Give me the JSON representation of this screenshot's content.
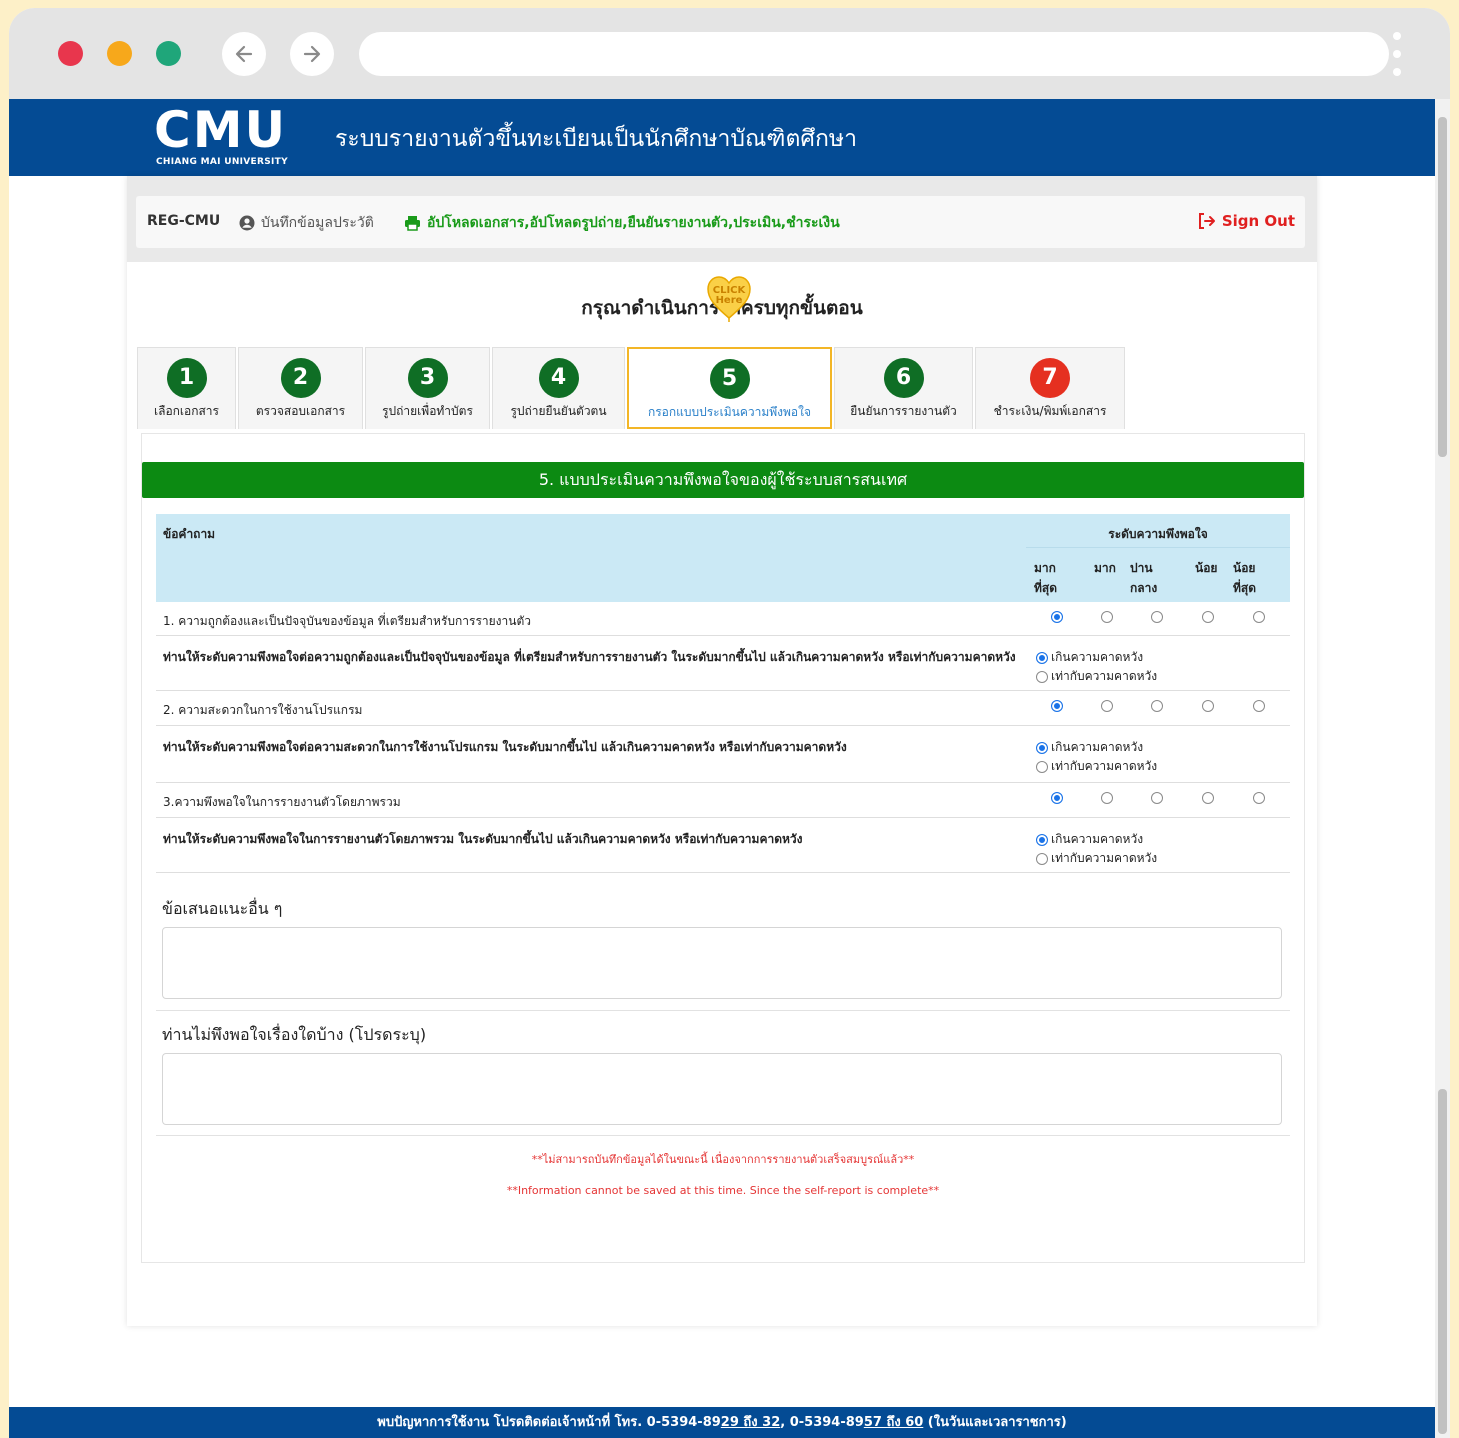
{
  "colors": {
    "header_blue": "#044b94",
    "step_green": "#0f6e25",
    "step_red": "#e53020",
    "panel_green": "#0c8a12",
    "active_tab_border": "#f3b626",
    "warning_red": "#e53535",
    "page_bg": "#fdf0c8"
  },
  "browser": {
    "url": ""
  },
  "header": {
    "logo": "CMU",
    "logo_sub": "CHIANG MAI UNIVERSITY",
    "title": "ระบบรายงานตัวขึ้นทะเบียนเป็นนักศึกษาบัณฑิตศึกษา"
  },
  "topnav": {
    "brand": "REG-CMU",
    "link1": "บันทึกข้อมูลประวัติ",
    "link2": "อัปโหลดเอกสาร,อัปโหลดรูปถ่าย,ยืนยันรายงานตัว,ประเมิน,ชำระเงิน",
    "signout": "Sign Out"
  },
  "step_title": "กรุณาดำเนินการให้ครบทุกขั้นตอน",
  "click_badge": {
    "line1": "CLICK",
    "line2": "Here"
  },
  "steps": [
    {
      "num": "1",
      "label": "เลือกเอกสาร"
    },
    {
      "num": "2",
      "label": "ตรวจสอบเอกสาร"
    },
    {
      "num": "3",
      "label": "รูปถ่ายเพื่อทำบัตร"
    },
    {
      "num": "4",
      "label": "รูปถ่ายยืนยันตัวตน"
    },
    {
      "num": "5",
      "label": "กรอกแบบประเมินความพึงพอใจ"
    },
    {
      "num": "6",
      "label": "ยืนยันการรายงานตัว"
    },
    {
      "num": "7",
      "label": "ชำระเงิน/พิมพ์เอกสาร"
    }
  ],
  "active_step": "5",
  "panel": {
    "heading": "5. แบบประเมินความพึงพอใจของผู้ใช้ระบบสารสนเทศ",
    "col_question": "ข้อคำถาม",
    "col_level": "ระดับความพึงพอใจ",
    "levels": [
      {
        "l1": "มาก",
        "l2": "ที่สุด"
      },
      {
        "l1": "มาก",
        "l2": ""
      },
      {
        "l1": "ปาน",
        "l2": "กลาง"
      },
      {
        "l1": "น้อย",
        "l2": ""
      },
      {
        "l1": "น้อย",
        "l2": "ที่สุด"
      }
    ],
    "questions": [
      {
        "text": "1. ความถูกต้องและเป็นปัจจุบันของข้อมูล ที่เตรียมสำหรับการรายงานตัว",
        "selected_level": 1,
        "followup": "ท่านให้ระดับความพึงพอใจต่อความถูกต้องและเป็นปัจจุบันของข้อมูล ที่เตรียมสำหรับการรายงานตัว ในระดับมากขึ้นไป แล้วเกินความคาดหวัง หรือเท่ากับความคาดหวัง",
        "opt_exceed": "เกินความคาดหวัง",
        "opt_equal": "เท่ากับความคาดหวัง",
        "selected_opt": "exceed"
      },
      {
        "text": "2. ความสะดวกในการใช้งานโปรแกรม",
        "selected_level": 1,
        "followup": "ท่านให้ระดับความพึงพอใจต่อความสะดวกในการใช้งานโปรแกรม ในระดับมากขึ้นไป แล้วเกินความคาดหวัง หรือเท่ากับความคาดหวัง",
        "opt_exceed": "เกินความคาดหวัง",
        "opt_equal": "เท่ากับความคาดหวัง",
        "selected_opt": "exceed"
      },
      {
        "text": "3.ความพึงพอใจในการรายงานตัวโดยภาพรวม",
        "selected_level": 1,
        "followup": "ท่านให้ระดับความพึงพอใจในการรายงานตัวโดยภาพรวม ในระดับมากขึ้นไป แล้วเกินความคาดหวัง หรือเท่ากับความคาดหวัง",
        "opt_exceed": "เกินความคาดหวัง",
        "opt_equal": "เท่ากับความคาดหวัง",
        "selected_opt": "exceed"
      }
    ],
    "suggest_label": "ข้อเสนอแนะอื่น ๆ",
    "suggest_value": "",
    "unsat_label": "ท่านไม่พึงพอใจเรื่องใดบ้าง (โปรดระบุ)",
    "unsat_value": "",
    "warning_th": "**ไม่สามารถบันทึกข้อมูลได้ในขณะนี้ เนื่องจากการรายงานตัวเสร็จสมบูรณ์แล้ว**",
    "warning_en": "**Information cannot be saved at this time. Since the self-report is complete**"
  },
  "footer": {
    "text_a": "พบปัญหาการใช้งาน โปรดติดต่อเจ้าหน้าที่ โทร. 0-5394-89",
    "link1": "29 ถึง 32",
    "text_b": ", 0-5394-89",
    "link2": "57 ถึง 60",
    "text_c": " (ในวันและเวลาราชการ)"
  },
  "icons": {
    "back": "arrow-left-icon",
    "forward": "arrow-right-icon",
    "search": "search-icon",
    "menu": "kebab-menu-icon",
    "user": "user-circle-icon",
    "print": "printer-icon",
    "signout": "sign-out-icon"
  }
}
